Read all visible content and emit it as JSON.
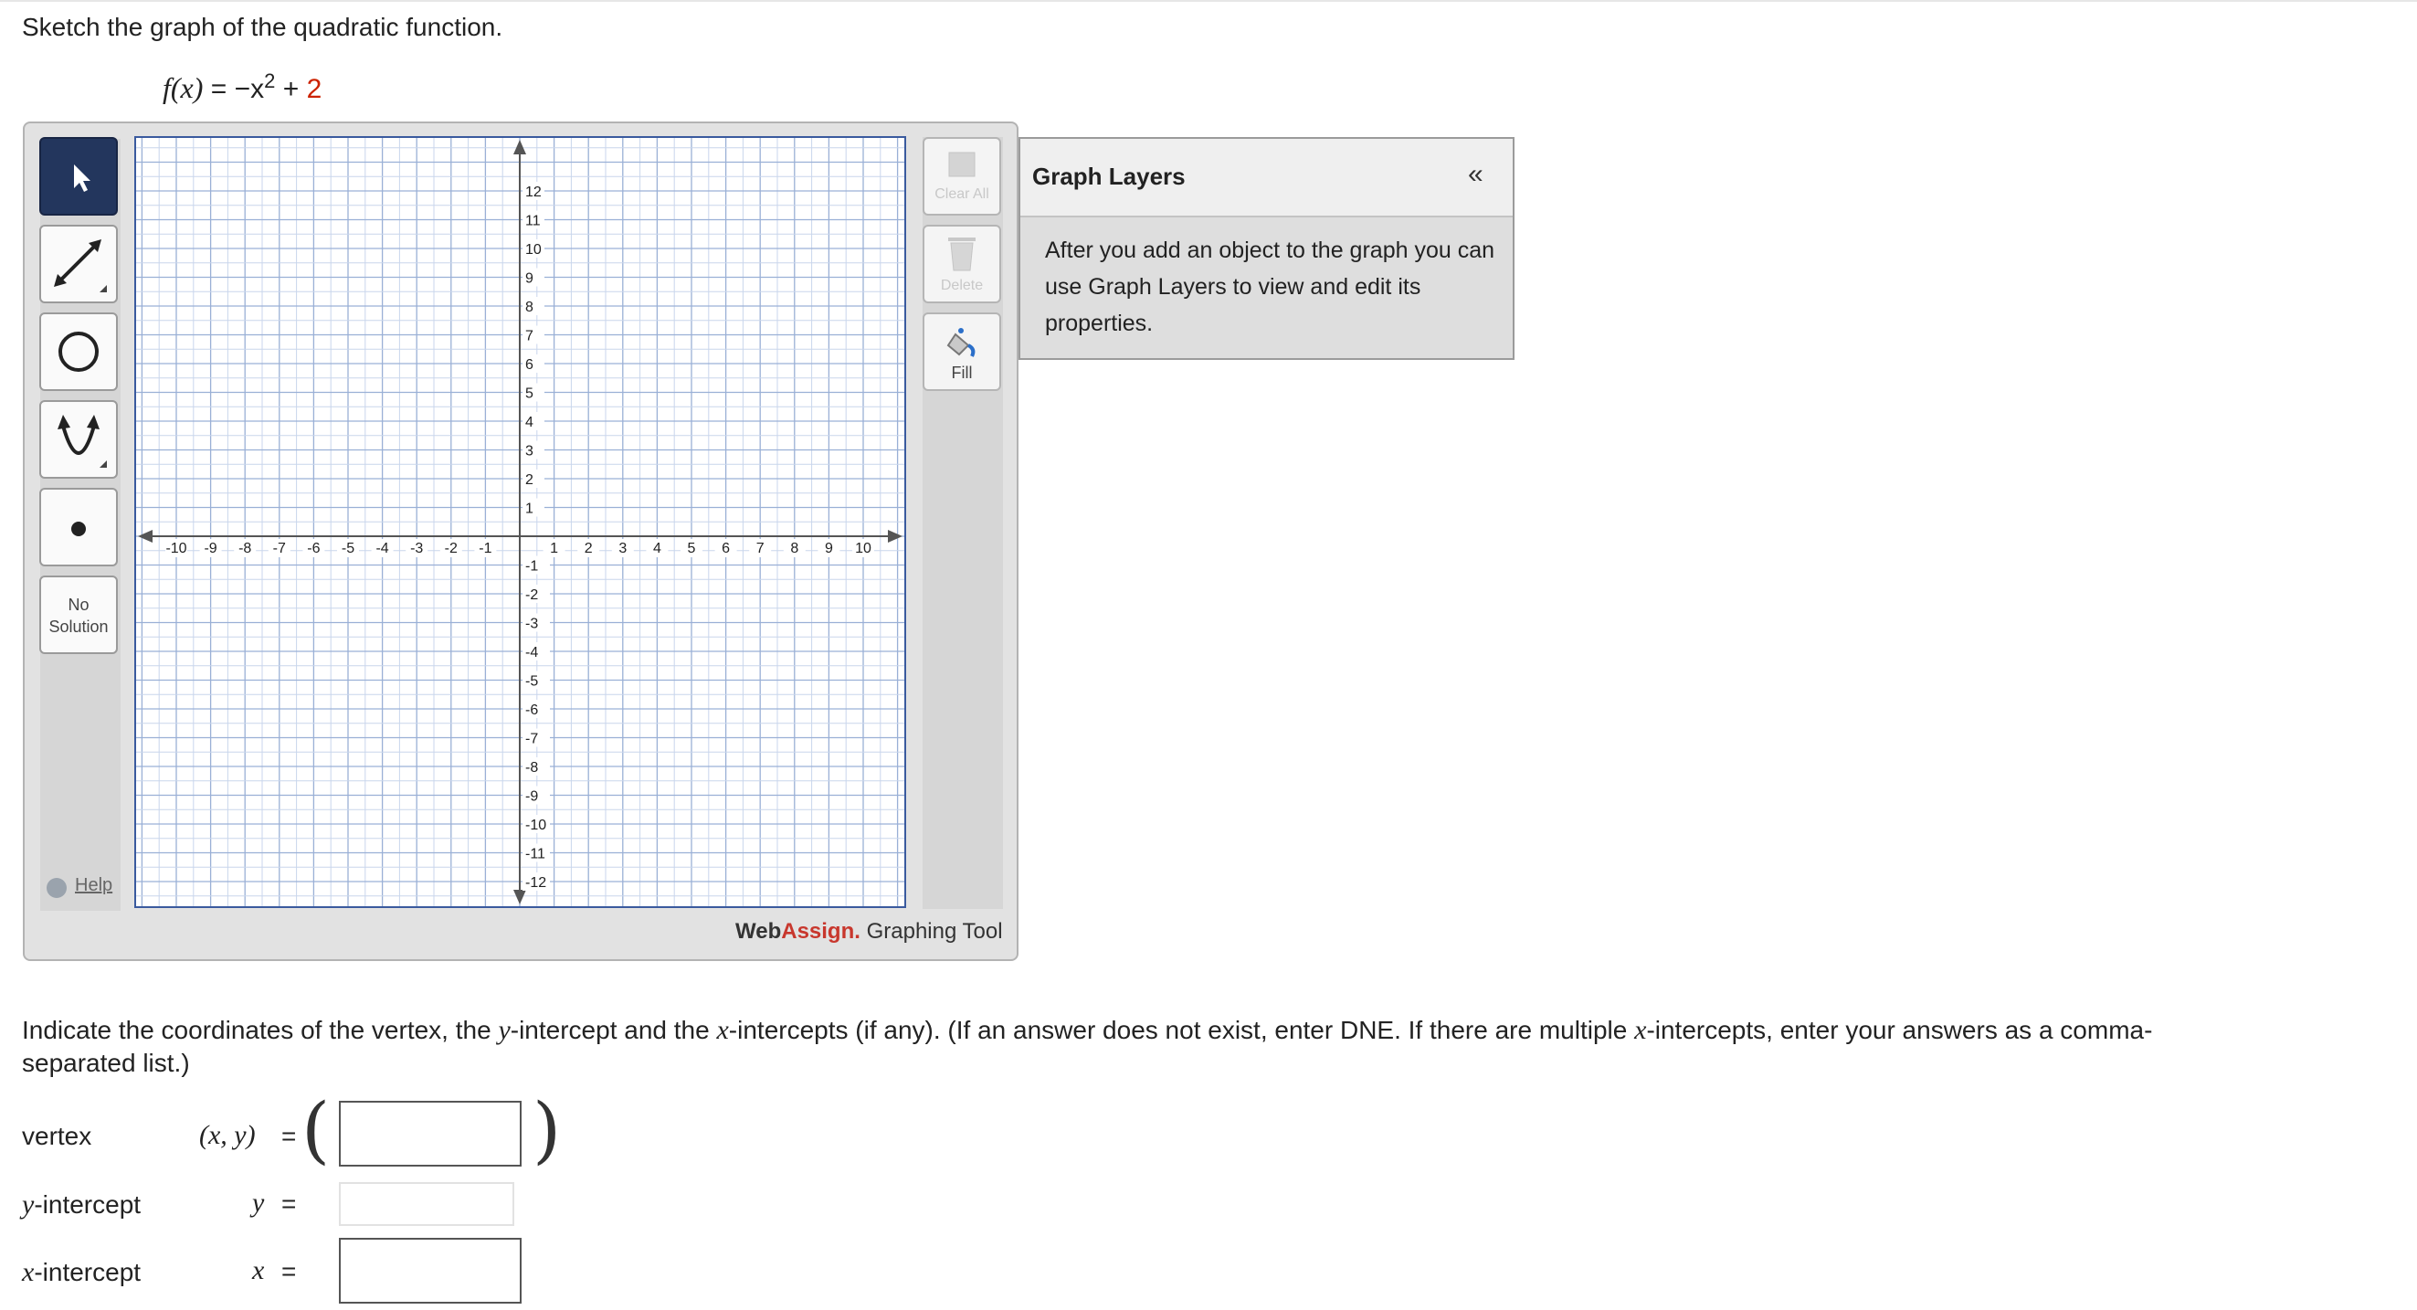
{
  "prompt": "Sketch the graph of the quadratic function.",
  "function": {
    "name": "f(x)",
    "equals": "=",
    "minus_x": "−x",
    "exponent": "2",
    "plus": "+",
    "constant": "2"
  },
  "tools": {
    "pointer": "pointer-tool",
    "line": "line-tool",
    "circle": "circle-tool",
    "parabola": "parabola-tool",
    "point": "point-tool",
    "no_solution_line1": "No",
    "no_solution_line2": "Solution"
  },
  "help_label": "Help",
  "graph": {
    "x_ticks": [
      "-10",
      "-9",
      "-8",
      "-7",
      "-6",
      "-5",
      "-4",
      "-3",
      "-2",
      "-1",
      "1",
      "2",
      "3",
      "4",
      "5",
      "6",
      "7",
      "8",
      "9",
      "10"
    ],
    "y_ticks_pos": [
      "12",
      "11",
      "10",
      "9",
      "8",
      "7",
      "6",
      "5",
      "4",
      "3",
      "2",
      "1"
    ],
    "y_ticks_neg": [
      "-1",
      "-2",
      "-3",
      "-4",
      "-5",
      "-6",
      "-7",
      "-8",
      "-9",
      "-10",
      "-11",
      "-12"
    ]
  },
  "side_buttons": {
    "clear_all": "Clear All",
    "delete": "Delete",
    "fill": "Fill"
  },
  "brand": {
    "web": "Web",
    "assign": "Assign.",
    "tool": "Graphing Tool"
  },
  "layers": {
    "title": "Graph Layers",
    "collapse": "«",
    "body": "After you add an object to the graph you can use Graph Layers to view and edit its properties."
  },
  "instructions": {
    "p1": "Indicate the coordinates of the vertex, the ",
    "y": "y",
    "p2": "-intercept and the ",
    "x": "x",
    "p3": "-intercepts (if any). (If an answer does not exist, enter DNE. If there are multiple ",
    "x2": "x",
    "p4": "-intercepts, enter your answers as a comma-",
    "p5": "separated list.)"
  },
  "answers": {
    "vertex_label": "vertex",
    "vertex_eq": "(x, y)",
    "y_label_var": "y",
    "y_label_rest": "-intercept",
    "y_eq": "y",
    "x_label_var": "x",
    "x_label_rest": "-intercept",
    "x_eq": "x",
    "equals": "=",
    "open_paren": "(",
    "close_paren": ")"
  }
}
